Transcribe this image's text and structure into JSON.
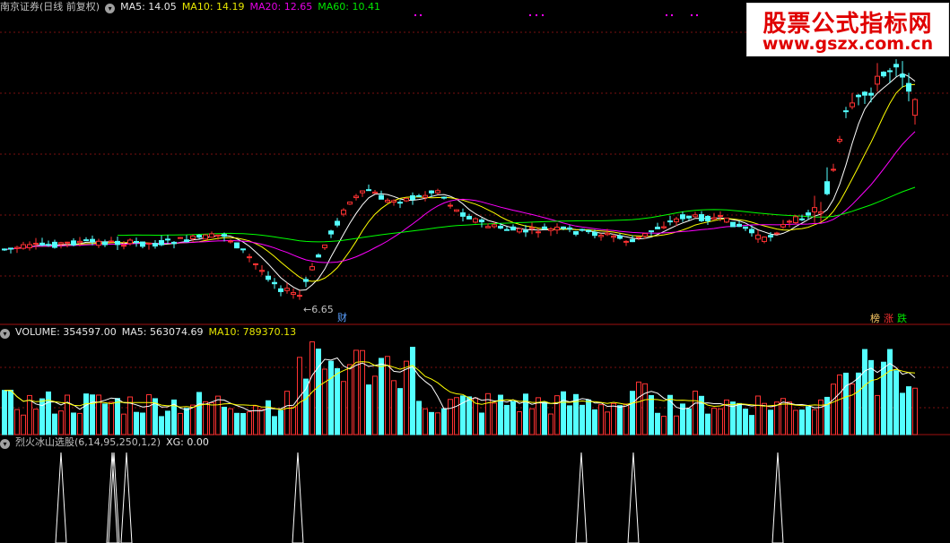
{
  "header": {
    "stock": "南京证券(日线 前复权)",
    "ma5": "MA5: 14.05",
    "ma10": "MA10: 14.19",
    "ma20": "MA20: 12.65",
    "ma60": "MA60: 10.41"
  },
  "volume_header": {
    "volume": "VOLUME: 354597.00",
    "ma5": "MA5: 563074.69",
    "ma10": "MA10: 789370.13"
  },
  "indicator_header": {
    "name": "烈火冰山选股(6,14,95,250,1,2)",
    "xg": "XG: 0.00"
  },
  "watermark": {
    "title": "股票公式指标网",
    "url": "www.gszx.com.cn"
  },
  "colors": {
    "up": "#ff3232",
    "down": "#54ffff",
    "ma5": "#ffffff",
    "ma10": "#ffff00",
    "ma20": "#ff00ff",
    "ma60": "#00ff00",
    "grid": "#7a1010",
    "separator": "#a01010"
  },
  "chart_data": [
    {
      "type": "candlestick",
      "low_label": "6.65",
      "markers": [
        "财",
        "榜",
        "涨",
        "跌"
      ],
      "series": [
        {
          "name": "MA5",
          "last": "14.05"
        },
        {
          "name": "MA10",
          "last": "14.19"
        },
        {
          "name": "MA20",
          "last": "12.65"
        },
        {
          "name": "MA60",
          "last": "10.41"
        }
      ]
    },
    {
      "type": "bar",
      "series": [
        {
          "name": "VOLUME",
          "last": "354597.00"
        },
        {
          "name": "MA5",
          "last": "563074.69"
        },
        {
          "name": "MA10",
          "last": "789370.13"
        }
      ]
    },
    {
      "type": "line",
      "series": [
        {
          "name": "XG",
          "last": "0.00"
        }
      ],
      "signal_count": 8
    }
  ]
}
